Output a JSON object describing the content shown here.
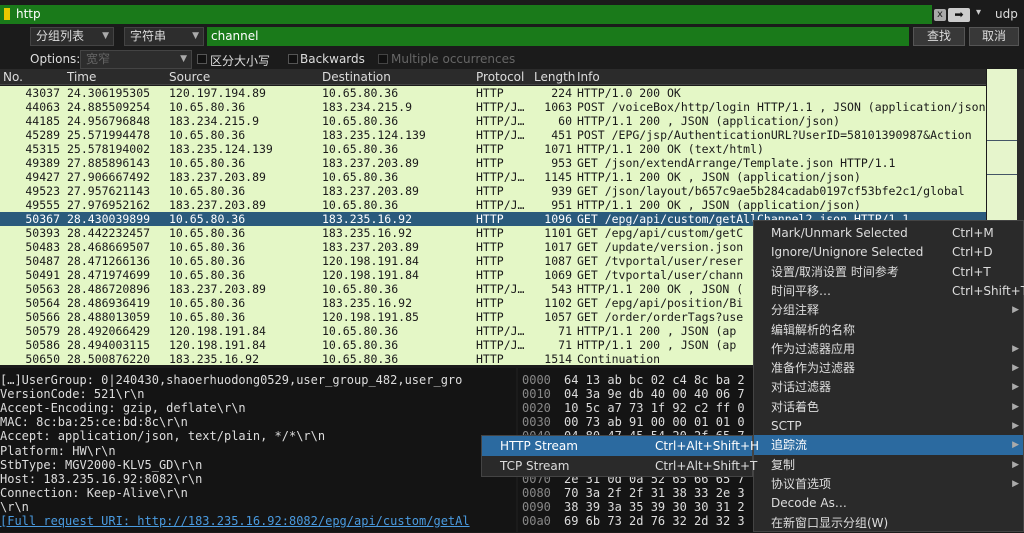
{
  "filter": {
    "value": "http",
    "clear_icon": "x",
    "apply_icon": "➡",
    "drop_icon": "▾",
    "proto_label": "udp"
  },
  "search": {
    "scope": "分组列表",
    "type": "字符串",
    "value": "channel",
    "find_label": "查找",
    "cancel_label": "取消"
  },
  "options": {
    "label": "Options:",
    "charset": "宽窄",
    "case_label": "区分大小写",
    "backwards_label": "Backwards",
    "multiple_label": "Multiple occurrences"
  },
  "columns": [
    "No.",
    "Time",
    "Source",
    "Destination",
    "Protocol",
    "Length",
    "Info"
  ],
  "rows": [
    {
      "no": "43037",
      "time": "24.306195305",
      "src": "120.197.194.89",
      "dst": "10.65.80.36",
      "proto": "HTTP",
      "len": "224",
      "info": "HTTP/1.0 200 OK"
    },
    {
      "no": "44063",
      "time": "24.885509254",
      "src": "10.65.80.36",
      "dst": "183.234.215.9",
      "proto": "HTTP/J…",
      "len": "1063",
      "info": "POST /voiceBox/http/login HTTP/1.1 , JSON (application/json)"
    },
    {
      "no": "44185",
      "time": "24.956796848",
      "src": "183.234.215.9",
      "dst": "10.65.80.36",
      "proto": "HTTP/J…",
      "len": "60",
      "info": "HTTP/1.1 200  , JSON (application/json)"
    },
    {
      "no": "45289",
      "time": "25.571994478",
      "src": "10.65.80.36",
      "dst": "183.235.124.139",
      "proto": "HTTP/J…",
      "len": "451",
      "info": "POST /EPG/jsp/AuthenticationURL?UserID=58101390987&Action"
    },
    {
      "no": "45315",
      "time": "25.578194002",
      "src": "183.235.124.139",
      "dst": "10.65.80.36",
      "proto": "HTTP",
      "len": "1071",
      "info": "HTTP/1.1 200 OK  (text/html)"
    },
    {
      "no": "49389",
      "time": "27.885896143",
      "src": "10.65.80.36",
      "dst": "183.237.203.89",
      "proto": "HTTP",
      "len": "953",
      "info": "GET /json/extendArrange/Template.json HTTP/1.1"
    },
    {
      "no": "49427",
      "time": "27.906667492",
      "src": "183.237.203.89",
      "dst": "10.65.80.36",
      "proto": "HTTP/J…",
      "len": "1145",
      "info": "HTTP/1.1 200 OK , JSON (application/json)"
    },
    {
      "no": "49523",
      "time": "27.957621143",
      "src": "10.65.80.36",
      "dst": "183.237.203.89",
      "proto": "HTTP",
      "len": "939",
      "info": "GET /json/layout/b657c9ae5b284cadab0197cf53bfe2c1/global"
    },
    {
      "no": "49555",
      "time": "27.976952162",
      "src": "183.237.203.89",
      "dst": "10.65.80.36",
      "proto": "HTTP/J…",
      "len": "951",
      "info": "HTTP/1.1 200 OK , JSON (application/json)"
    },
    {
      "no": "50367",
      "time": "28.430039899",
      "src": "10.65.80.36",
      "dst": "183.235.16.92",
      "proto": "HTTP",
      "len": "1096",
      "info": "GET /epg/api/custom/getAllChannel2.json HTTP/1.1",
      "selected": true
    },
    {
      "no": "50393",
      "time": "28.442232457",
      "src": "10.65.80.36",
      "dst": "183.235.16.92",
      "proto": "HTTP",
      "len": "1101",
      "info": "GET /epg/api/custom/getC"
    },
    {
      "no": "50483",
      "time": "28.468669507",
      "src": "10.65.80.36",
      "dst": "183.237.203.89",
      "proto": "HTTP",
      "len": "1017",
      "info": "GET /update/version.json"
    },
    {
      "no": "50487",
      "time": "28.471266136",
      "src": "10.65.80.36",
      "dst": "120.198.191.84",
      "proto": "HTTP",
      "len": "1087",
      "info": "GET /tvportal/user/reser"
    },
    {
      "no": "50491",
      "time": "28.471974699",
      "src": "10.65.80.36",
      "dst": "120.198.191.84",
      "proto": "HTTP",
      "len": "1069",
      "info": "GET /tvportal/user/chann"
    },
    {
      "no": "50563",
      "time": "28.486720896",
      "src": "183.237.203.89",
      "dst": "10.65.80.36",
      "proto": "HTTP/J…",
      "len": "543",
      "info": "HTTP/1.1 200 OK , JSON ("
    },
    {
      "no": "50564",
      "time": "28.486936419",
      "src": "10.65.80.36",
      "dst": "183.235.16.92",
      "proto": "HTTP",
      "len": "1102",
      "info": "GET /epg/api/position/Bi"
    },
    {
      "no": "50566",
      "time": "28.488013059",
      "src": "10.65.80.36",
      "dst": "120.198.191.85",
      "proto": "HTTP",
      "len": "1057",
      "info": "GET /order/orderTags?use"
    },
    {
      "no": "50579",
      "time": "28.492066429",
      "src": "120.198.191.84",
      "dst": "10.65.80.36",
      "proto": "HTTP/J…",
      "len": "71",
      "info": "HTTP/1.1 200  , JSON (ap"
    },
    {
      "no": "50586",
      "time": "28.494003115",
      "src": "120.198.191.84",
      "dst": "10.65.80.36",
      "proto": "HTTP/J…",
      "len": "71",
      "info": "HTTP/1.1 200  , JSON (ap"
    },
    {
      "no": "50650",
      "time": "28.500876220",
      "src": "183.235.16.92",
      "dst": "10.65.80.36",
      "proto": "HTTP",
      "len": "1514",
      "info": "Continuation"
    }
  ],
  "details": [
    "  […]UserGroup: 0|240430,shaoerhuodong0529,user_group_482,user_gro",
    "  VersionCode: 521\\r\\n",
    "  Accept-Encoding: gzip, deflate\\r\\n",
    "  MAC: 8c:ba:25:ce:bd:8c\\r\\n",
    "  Accept: application/json, text/plain, */*\\r\\n",
    "  Platform: HW\\r\\n",
    "  StbType: MGV2000-KLV5_GD\\r\\n",
    "  Host: 183.235.16.92:8082\\r\\n",
    "  Connection: Keep-Alive\\r\\n",
    "  \\r\\n",
    "  [Full request URI: http://183.235.16.92:8082/epg/api/custom/getAl"
  ],
  "bytes": [
    {
      "off": "0000",
      "hex": "64 13 ab bc 02 c4 8c ba  2"
    },
    {
      "off": "0010",
      "hex": "04 3a 9e db 40 00 40 06  7"
    },
    {
      "off": "0020",
      "hex": "10 5c a7 73 1f 92 c2 ff  0"
    },
    {
      "off": "0030",
      "hex": "00 73 ab 91 00 00 01 01  0"
    },
    {
      "off": "0040",
      "hex": "04 80 47 45 54 20 2f 65  7"
    },
    {
      "off": "0050",
      "hex": ""
    },
    {
      "off": "0060",
      "hex": ""
    },
    {
      "off": "0070",
      "hex": "2e 31 0d 0a 52 65 66 65  7"
    },
    {
      "off": "0080",
      "hex": "70 3a 2f 2f 31 38 33 2e  3"
    },
    {
      "off": "0090",
      "hex": "38 39 3a 35 39 30 30 31  2"
    },
    {
      "off": "00a0",
      "hex": "69 6b 73 2d 76 32 2d 32  3"
    }
  ],
  "context_menu": [
    {
      "label": "Mark/Unmark Selected",
      "shortcut": "Ctrl+M"
    },
    {
      "label": "Ignore/Unignore Selected",
      "shortcut": "Ctrl+D"
    },
    {
      "label": "设置/取消设置 时间参考",
      "shortcut": "Ctrl+T"
    },
    {
      "label": "时间平移…",
      "shortcut": "Ctrl+Shift+T"
    },
    {
      "label": "分组注释",
      "shortcut": "",
      "sub": true
    },
    {
      "label": "编辑解析的名称",
      "shortcut": ""
    },
    {
      "label": "作为过滤器应用",
      "shortcut": "",
      "sub": true
    },
    {
      "label": "准备作为过滤器",
      "shortcut": "",
      "sub": true
    },
    {
      "label": "对话过滤器",
      "shortcut": "",
      "sub": true
    },
    {
      "label": "对话着色",
      "shortcut": "",
      "sub": true
    },
    {
      "label": "SCTP",
      "shortcut": "",
      "sub": true
    },
    {
      "label": "追踪流",
      "shortcut": "",
      "sub": true,
      "highlight": true
    },
    {
      "label": "复制",
      "shortcut": "",
      "sub": true
    },
    {
      "label": "协议首选项",
      "shortcut": "",
      "sub": true
    },
    {
      "label": "Decode As…",
      "shortcut": ""
    },
    {
      "label": "在新窗口显示分组(W)",
      "shortcut": ""
    }
  ],
  "submenu": [
    {
      "label": "HTTP Stream",
      "shortcut": "Ctrl+Alt+Shift+H",
      "highlight": true
    },
    {
      "label": "TCP Stream",
      "shortcut": "Ctrl+Alt+Shift+T"
    }
  ],
  "colors": {
    "row_bg": "#e4f7c6",
    "selected_bg": "#2a5a7c",
    "filter_bg": "#1a7a1a",
    "menu_highlight": "#2b6aa0"
  }
}
